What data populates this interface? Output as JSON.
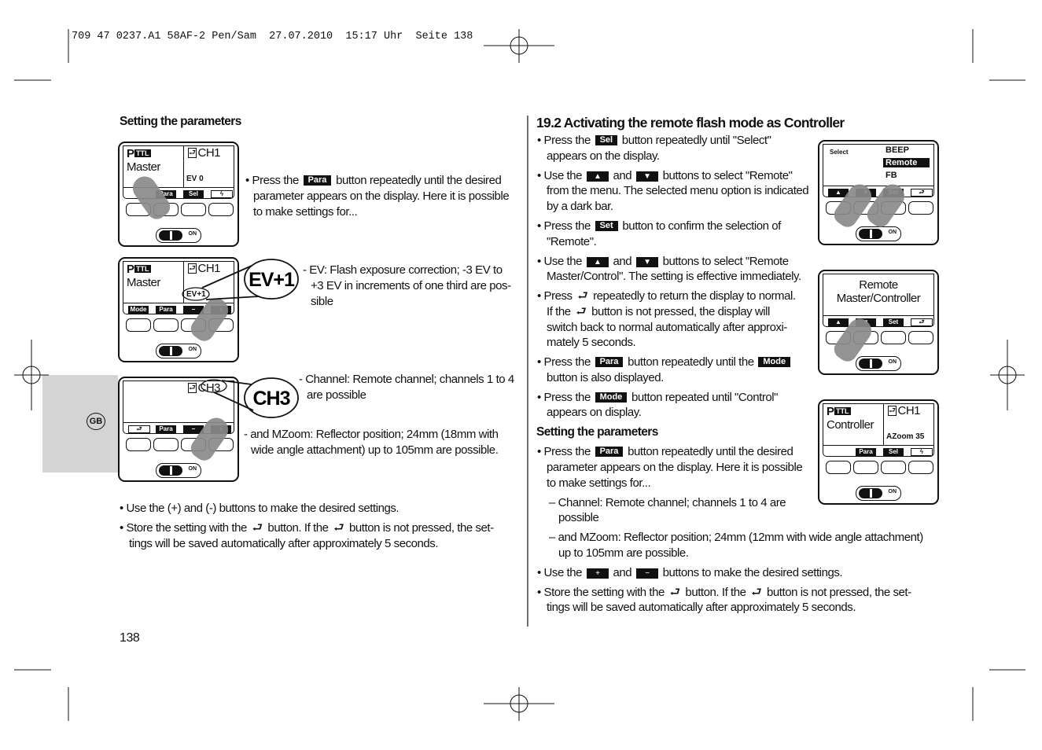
{
  "header": "709 47 0237.A1 58AF-2 Pen/Sam  27.07.2010  15:17 Uhr  Seite 138",
  "language_tab": "GB",
  "page_number": "138",
  "callouts": {
    "ev": "EV+1",
    "ch": "CH3"
  },
  "devices": [
    {
      "mode": "P",
      "ttl": "TTL",
      "name": "Master",
      "channel": "CH1",
      "param": "EV 0",
      "softkeys": [
        "",
        "Para",
        "Sel",
        "flash-icon"
      ]
    },
    {
      "mode": "P",
      "ttl": "TTL",
      "name": "Master",
      "channel": "CH1",
      "param": "EV+1",
      "softkeys": [
        "Mode",
        "Para",
        "−",
        "+"
      ]
    },
    {
      "channel": "CH3",
      "softkeys": [
        "return-icon",
        "Para",
        "−",
        "+"
      ]
    },
    {
      "select": "Select",
      "menu": [
        "BEEP",
        "Remote",
        "FB"
      ],
      "selected": "Remote",
      "softkeys": [
        "up-icon",
        "down-icon",
        "Set",
        "return-icon"
      ]
    },
    {
      "text": [
        "Remote",
        "Master/Controller"
      ],
      "softkeys": [
        "up-icon",
        "down-icon",
        "Set",
        "return-icon"
      ]
    },
    {
      "mode": "P",
      "ttl": "TTL",
      "name": "Controller",
      "channel": "CH1",
      "param": "AZoom  35",
      "softkeys": [
        "",
        "Para",
        "Sel",
        "flash-icon"
      ]
    }
  ],
  "switch_label": "ON",
  "left_text": [
    [
      {
        "t": "Setting the parameters",
        "style": "b"
      }
    ],
    [
      "• Press the ",
      {
        "key": "Para"
      },
      " button repeatedly until the desired"
    ],
    [
      "parameter appears on the display. Here it is possible"
    ],
    [
      "to make settings for..."
    ],
    [
      "- EV: Flash exposure correction; -3 EV to"
    ],
    [
      "+3 EV in increments of one third are pos-"
    ],
    [
      "sible"
    ],
    [
      "- Channel: Remote channel; channels 1 to 4"
    ],
    [
      "are possible"
    ],
    [
      "- and MZoom: Reflector position; 24mm (18mm with"
    ],
    [
      "wide angle attachment) up to 105mm are possible."
    ],
    [
      "• Use the (+) and (-) buttons to make the desired settings."
    ],
    [
      "• Store the setting with the ",
      {
        "icon": "return-icon"
      },
      " button. If the ",
      {
        "icon": "return-icon"
      },
      " button is not pressed, the set-"
    ],
    [
      "tings will be saved automatically after approximately 5 seconds."
    ]
  ],
  "right_text": [
    [
      {
        "t": "19.2 Activating the remote flash mode as Controller",
        "style": "h"
      }
    ],
    [
      "• Press the ",
      {
        "key": "Sel"
      },
      " button repeatedly until \"Select\""
    ],
    [
      "appears on the display."
    ],
    [
      "• Use the ",
      {
        "icon": "up-icon"
      },
      " and ",
      {
        "icon": "down-icon"
      },
      " buttons to select \"Remote\""
    ],
    [
      "from the menu. The selected menu option is indicated"
    ],
    [
      "by a dark bar."
    ],
    [
      "• Press the ",
      {
        "key": "Set"
      },
      " button to confirm the selection of"
    ],
    [
      "\"Remote\"."
    ],
    [
      "• Use the ",
      {
        "icon": "up-icon"
      },
      " and ",
      {
        "icon": "down-icon"
      },
      " buttons to select \"Remote"
    ],
    [
      "Master/Control\". The setting is effective immediately."
    ],
    [
      "• Press ",
      {
        "icon": "return-icon"
      },
      " repeatedly to return the display to normal."
    ],
    [
      "If the ",
      {
        "icon": "return-icon"
      },
      " button is not pressed, the display will"
    ],
    [
      "switch back to normal automatically after approxi-"
    ],
    [
      "mately 5 seconds."
    ],
    [
      "• Press the ",
      {
        "key": "Para"
      },
      " button repeatedly until the ",
      {
        "key": "Mode"
      }
    ],
    [
      "button is also displayed."
    ],
    [
      "• Press the ",
      {
        "key": "Mode"
      },
      " button repeated until \"Control\""
    ],
    [
      "appears on display."
    ],
    [
      {
        "t": "Setting the parameters",
        "style": "b"
      }
    ],
    [
      "• Press the ",
      {
        "key": "Para"
      },
      " button repeatedly until the desired"
    ],
    [
      "parameter appears on the display. Here it is possible"
    ],
    [
      "to make settings for..."
    ],
    [
      "– Channel: Remote channel; channels 1 to 4 are"
    ],
    [
      "possible"
    ],
    [
      "– and MZoom: Reflector position; 24mm (12mm with wide angle attachment)"
    ],
    [
      "up to 105mm are possible."
    ],
    [
      "• Use the ",
      {
        "icon": "plus-icon"
      },
      " and ",
      {
        "icon": "minus-icon"
      },
      " buttons to make the desired settings."
    ],
    [
      "• Store the setting with the ",
      {
        "icon": "return-icon"
      },
      " button. If the ",
      {
        "icon": "return-icon"
      },
      " button is not pressed, the set-"
    ],
    [
      "tings will be saved automatically after approximately 5 seconds."
    ]
  ]
}
